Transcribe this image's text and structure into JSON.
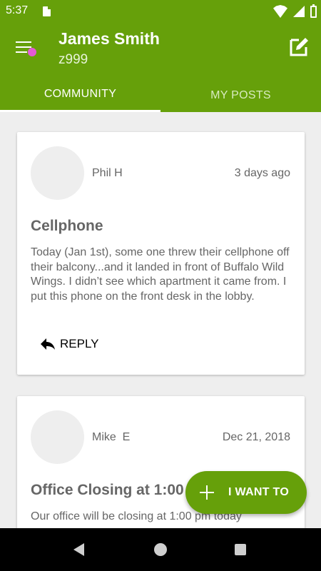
{
  "status_bar": {
    "time": "5:37"
  },
  "header": {
    "user_name": "James Smith",
    "user_id": "z999",
    "tabs": [
      {
        "label": "COMMUNITY",
        "active": true
      },
      {
        "label": "MY POSTS",
        "active": false
      }
    ]
  },
  "posts": [
    {
      "author": "Phil H",
      "date": "3 days ago",
      "title": "Cellphone",
      "body": "Today (Jan 1st), some one threw their cellphone off their balcony...and it landed in front of Buffalo Wild Wings.  I didn’t see which apartment it came from.  I put this phone on the front desk in the lobby.",
      "reply_label": "REPLY"
    },
    {
      "author": "Mike  E",
      "date": "Dec 21, 2018",
      "title": "Office Closing at 1:00",
      "body": "Our office will be closing at 1:00 pm today"
    }
  ],
  "fab": {
    "label": "I WANT TO"
  },
  "colors": {
    "primary": "#66a00a",
    "notification_dot": "#e45ad7"
  },
  "icons": [
    "sd-card-icon",
    "wifi-icon",
    "signal-icon",
    "battery-icon",
    "menu-icon",
    "compose-icon",
    "reply-icon",
    "plus-icon",
    "back-icon",
    "home-icon",
    "recents-icon"
  ]
}
